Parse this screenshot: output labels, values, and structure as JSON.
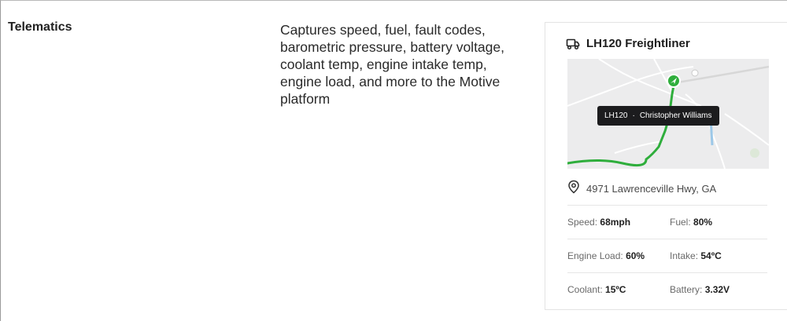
{
  "row": {
    "label": "Telematics",
    "description": "Captures speed, fuel, fault codes, barometric pressure, battery voltage, coolant temp, engine intake temp, engine load, and more to the Motive platform"
  },
  "card": {
    "icon": "truck-icon",
    "title": "LH120 Freightliner",
    "map": {
      "tooltip_vehicle": "LH120",
      "tooltip_separator": "·",
      "tooltip_driver": "Christopher Williams",
      "route_color": "#2fae3c",
      "marker_color": "#2fae3c"
    },
    "address_icon": "location-pin-icon",
    "address": "4971 Lawrenceville Hwy, GA",
    "metrics": [
      {
        "label": "Speed:",
        "value": "68mph"
      },
      {
        "label": "Fuel:",
        "value": "80%"
      },
      {
        "label": "Engine Load:",
        "value": "60%"
      },
      {
        "label": "Intake:",
        "value": "54ºC"
      },
      {
        "label": "Coolant:",
        "value": "15ºC"
      },
      {
        "label": "Battery:",
        "value": "3.32V"
      }
    ]
  }
}
